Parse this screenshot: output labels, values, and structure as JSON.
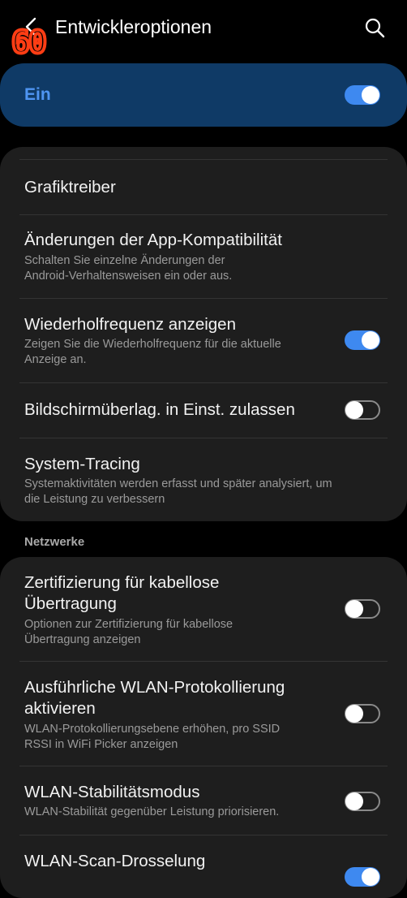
{
  "header": {
    "title": "Entwickleroptionen",
    "fps_overlay": "60"
  },
  "master": {
    "label": "Ein",
    "enabled": true
  },
  "groups": [
    {
      "items": [
        {
          "title": "Grafiktreiber"
        },
        {
          "title": "Änderungen der App-Kompatibilität",
          "subtitle_lines": [
            "Schalten Sie einzelne Änderungen der",
            "Android-Verhaltensweisen ein oder aus."
          ]
        },
        {
          "title": "Wiederholfrequenz anzeigen",
          "subtitle_lines": [
            "Zeigen Sie die Wiederholfrequenz für die aktuelle",
            "Anzeige an."
          ],
          "enabled": true
        },
        {
          "title": "Bildschirmüberlag. in Einst. zulassen",
          "enabled": false
        },
        {
          "title": "System-Tracing",
          "subtitle_lines": [
            "Systemaktivitäten werden erfasst und später analysiert, um",
            "die Leistung zu verbessern"
          ]
        }
      ]
    },
    {
      "header": "Netzwerke",
      "items": [
        {
          "title_lines": [
            "Zertifizierung für kabellose",
            "Übertragung"
          ],
          "subtitle_lines": [
            "Optionen zur Zertifizierung für kabellose",
            "Übertragung anzeigen"
          ],
          "enabled": false
        },
        {
          "title_lines": [
            "Ausführliche WLAN-Protokollierung",
            "aktivieren"
          ],
          "subtitle_lines": [
            "WLAN-Protokollierungsebene erhöhen, pro SSID",
            "RSSI in WiFi Picker anzeigen"
          ],
          "enabled": false
        },
        {
          "title": "WLAN-Stabilitätsmodus",
          "subtitle_lines": [
            "WLAN-Stabilität gegenüber Leistung priorisieren."
          ],
          "enabled": false
        },
        {
          "title": "WLAN-Scan-Drosselung",
          "enabled": true
        }
      ]
    }
  ],
  "colors": {
    "accent": "#3e89f0",
    "master_background": "#0f3a66",
    "card_background": "#1e1e1e",
    "fps_overlay": "#ff3d14"
  },
  "icons": {
    "back": "arrow-left-icon",
    "search": "search-icon"
  }
}
